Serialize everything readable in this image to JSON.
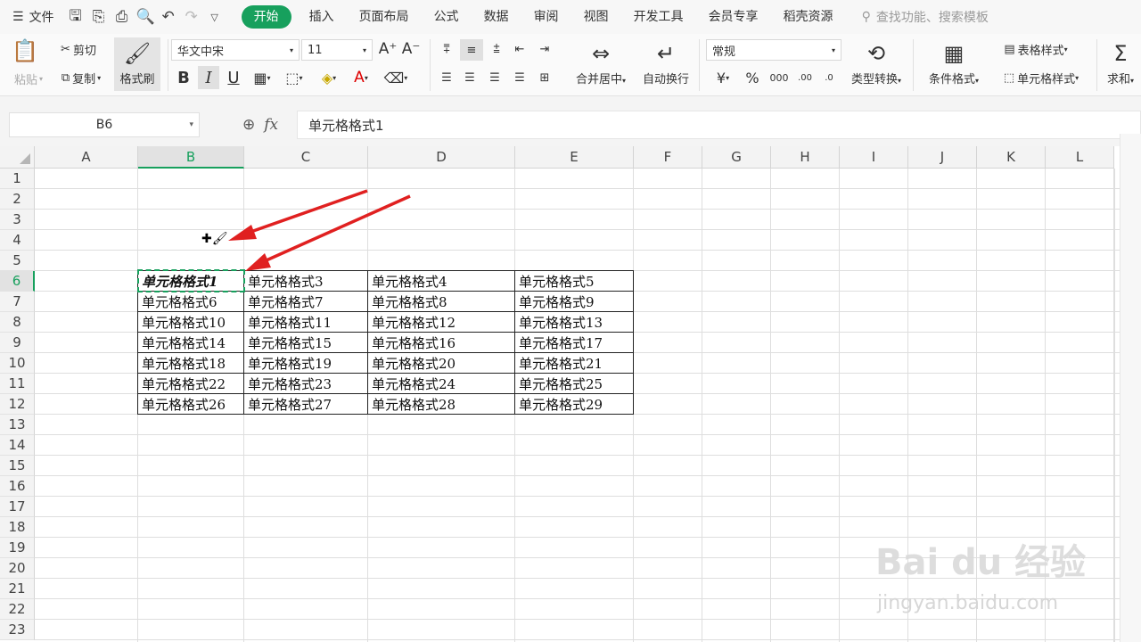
{
  "menubar": {
    "file_label": "文件",
    "tabs": [
      "开始",
      "插入",
      "页面布局",
      "公式",
      "数据",
      "审阅",
      "视图",
      "开发工具",
      "会员专享",
      "稻壳资源"
    ],
    "active_tab": "开始",
    "search_placeholder": "查找功能、搜索模板"
  },
  "ribbon": {
    "paste": "粘贴",
    "cut": "剪切",
    "copy": "复制",
    "format_painter": "格式刷",
    "font_name": "华文中宋",
    "font_size": "11",
    "bold": "B",
    "italic": "I",
    "underline": "U",
    "merge_center": "合并居中",
    "wrap_text": "自动换行",
    "number_format": "常规",
    "currency": "¥",
    "percent": "%",
    "thousands": "000",
    "dec_inc": ".00",
    "dec_dec": ".0",
    "type_convert": "类型转换",
    "cond_format": "条件格式",
    "table_style": "表格样式",
    "cell_style": "单元格样式",
    "sum": "求和"
  },
  "formula_bar": {
    "name_box": "B6",
    "fx": "fx",
    "content": "单元格格式1"
  },
  "columns": [
    "A",
    "B",
    "C",
    "D",
    "E",
    "F",
    "G",
    "H",
    "I",
    "J",
    "K",
    "L"
  ],
  "selected_column": "B",
  "rows": [
    "1",
    "2",
    "3",
    "4",
    "5",
    "6",
    "7",
    "8",
    "9",
    "10",
    "11",
    "12",
    "13",
    "14",
    "15",
    "16",
    "17",
    "18",
    "19",
    "20",
    "21",
    "22",
    "23"
  ],
  "selected_row": "6",
  "table": [
    [
      "单元格格式1",
      "单元格格式3",
      "单元格格式4",
      "单元格格式5"
    ],
    [
      "单元格格式6",
      "单元格格式7",
      "单元格格式8",
      "单元格格式9"
    ],
    [
      "单元格格式10",
      "单元格格式11",
      "单元格格式12",
      "单元格格式13"
    ],
    [
      "单元格格式14",
      "单元格格式15",
      "单元格格式16",
      "单元格格式17"
    ],
    [
      "单元格格式18",
      "单元格格式19",
      "单元格格式20",
      "单元格格式21"
    ],
    [
      "单元格格式22",
      "单元格格式23",
      "单元格格式24",
      "单元格格式25"
    ],
    [
      "单元格格式26",
      "单元格格式27",
      "单元格格式28",
      "单元格格式29"
    ]
  ],
  "watermark": {
    "main": "Bai du 经验",
    "sub": "jingyan.baidu.com"
  },
  "colors": {
    "accent": "#17a05d",
    "arrow": "#e02020"
  }
}
